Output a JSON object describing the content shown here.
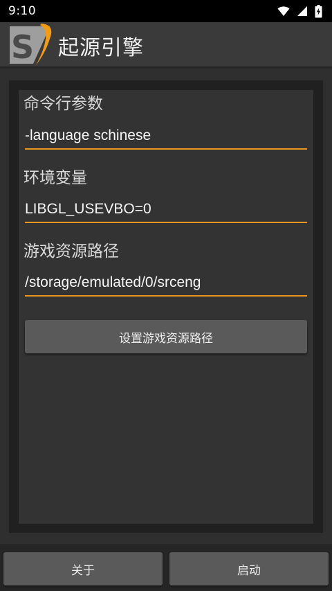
{
  "status_bar": {
    "time": "9:10",
    "icons": [
      "wifi-icon",
      "signal-icon",
      "battery-charging-icon"
    ]
  },
  "app_bar": {
    "title": "起源引擎",
    "logo_letter": "S",
    "accent_color": "#f39c12"
  },
  "form": {
    "command_line": {
      "label": "命令行参数",
      "value": "-language schinese"
    },
    "env_vars": {
      "label": "环境变量",
      "value": "LIBGL_USEVBO=0"
    },
    "game_path": {
      "label": "游戏资源路径",
      "value": "/storage/emulated/0/srceng"
    },
    "set_path_button": "设置游戏资源路径"
  },
  "bottom": {
    "about_button": "关于",
    "launch_button": "启动"
  }
}
